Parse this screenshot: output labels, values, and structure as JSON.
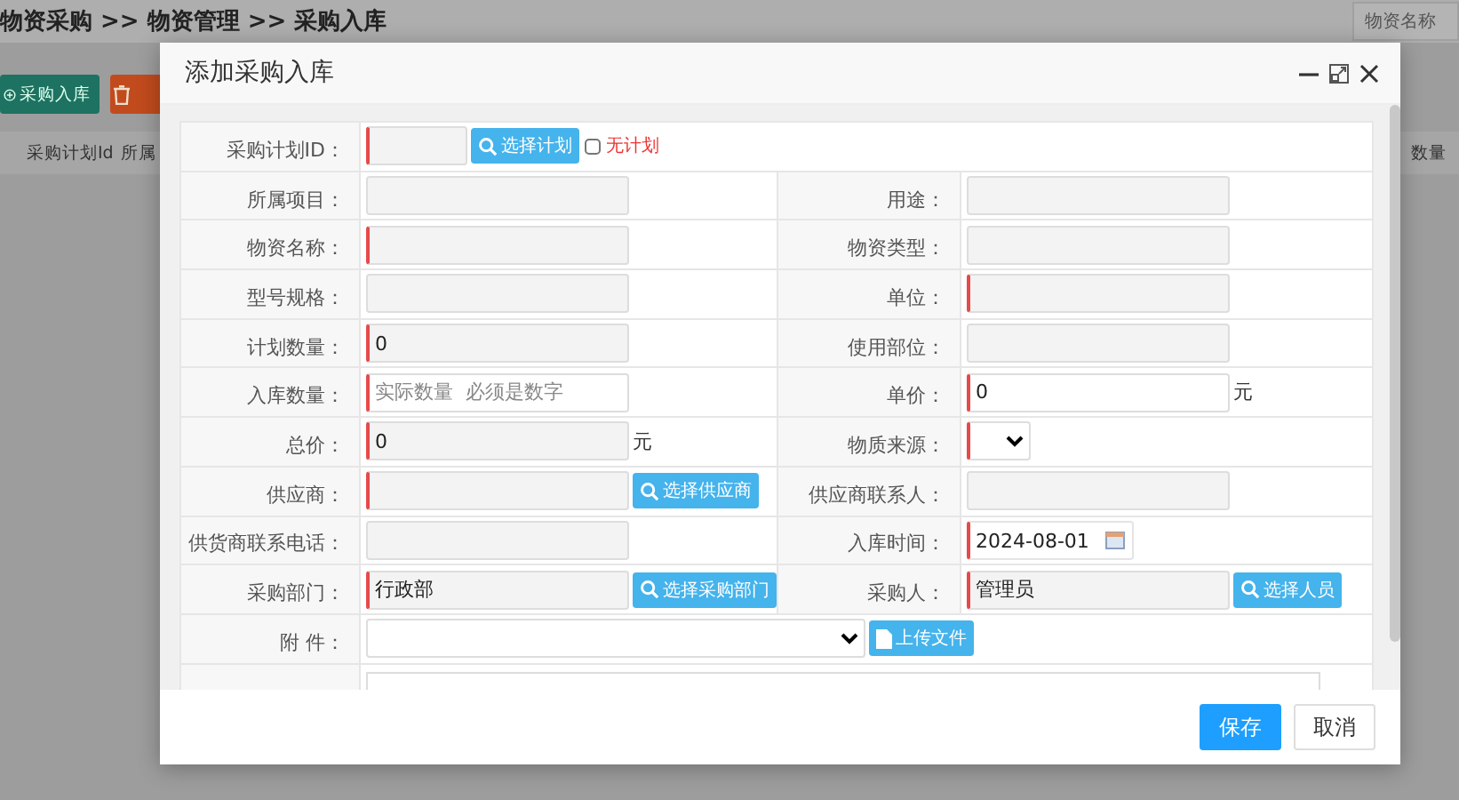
{
  "page": {
    "breadcrumb": "物资采购 >> 物资管理 >> 采购入库",
    "search_placeholder": "物资名称",
    "toolbar": [
      {
        "kind": "add",
        "label": "采购入库"
      },
      {
        "kind": "delete"
      }
    ],
    "columns": [
      "采购计划Id",
      "所属",
      "数量"
    ]
  },
  "dialog": {
    "title": "添加采购入库",
    "rows": [
      {
        "cells": [
          {
            "label": "采购计划ID：",
            "control": {
              "kind": "short",
              "required": true,
              "readonly": true,
              "button": {
                "label": "选择计划",
                "kind": "search"
              },
              "checkbox": {
                "label": "无计划",
                "checked": false
              }
            }
          }
        ]
      },
      {
        "cells": [
          {
            "label": "所属项目：",
            "control": {
              "kind": "text",
              "required": false,
              "readonly": true
            }
          },
          {
            "label": "用途：",
            "control": {
              "kind": "text",
              "required": false,
              "readonly": true
            }
          }
        ]
      },
      {
        "cells": [
          {
            "label": "物资名称：",
            "control": {
              "kind": "text",
              "required": true,
              "readonly": true
            }
          },
          {
            "label": "物资类型：",
            "control": {
              "kind": "text",
              "required": false,
              "readonly": true
            }
          }
        ]
      },
      {
        "cells": [
          {
            "label": "型号规格：",
            "control": {
              "kind": "text",
              "required": false,
              "readonly": true
            }
          },
          {
            "label": "单位：",
            "control": {
              "kind": "text",
              "required": true,
              "readonly": true
            }
          }
        ]
      },
      {
        "cells": [
          {
            "label": "计划数量：",
            "control": {
              "kind": "text",
              "value": "0",
              "required": true,
              "readonly": true
            }
          },
          {
            "label": "使用部位：",
            "control": {
              "kind": "text",
              "required": false,
              "readonly": true
            }
          }
        ]
      },
      {
        "cells": [
          {
            "label": "入库数量：",
            "control": {
              "kind": "text",
              "placeholder": "实际数量  必须是数字",
              "required": true,
              "readonly": false
            }
          },
          {
            "label": "单价：",
            "control": {
              "kind": "text",
              "value": "0",
              "required": true,
              "readonly": false,
              "suffix": "元"
            }
          }
        ]
      },
      {
        "cells": [
          {
            "label": "总价：",
            "control": {
              "kind": "text",
              "value": "0",
              "required": true,
              "readonly": true,
              "suffix": "元"
            }
          },
          {
            "label": "物质来源：",
            "control": {
              "kind": "select",
              "required": true
            }
          }
        ]
      },
      {
        "cells": [
          {
            "label": "供应商：",
            "control": {
              "kind": "text",
              "required": true,
              "readonly": true,
              "button": {
                "label": "选择供应商",
                "kind": "search"
              }
            }
          },
          {
            "label": "供应商联系人：",
            "control": {
              "kind": "text",
              "required": false,
              "readonly": true
            }
          }
        ]
      },
      {
        "cells": [
          {
            "label": "供货商联系电话：",
            "control": {
              "kind": "text",
              "required": false,
              "readonly": true
            }
          },
          {
            "label": "入库时间：",
            "control": {
              "kind": "date",
              "value": "2024-08-01",
              "required": true
            }
          }
        ]
      },
      {
        "cells": [
          {
            "label": "采购部门：",
            "control": {
              "kind": "text",
              "value": "行政部",
              "required": true,
              "readonly": true,
              "button": {
                "label": "选择采购部门",
                "kind": "search"
              }
            }
          },
          {
            "label": "采购人：",
            "control": {
              "kind": "text",
              "value": "管理员",
              "required": true,
              "readonly": true,
              "button": {
                "label": "选择人员",
                "kind": "search"
              }
            }
          }
        ]
      },
      {
        "cells": [
          {
            "label": "附 件：",
            "control": {
              "kind": "wideselect",
              "required": false,
              "button": {
                "label": "上传文件",
                "kind": "file"
              }
            }
          }
        ]
      },
      {
        "cells": [
          {
            "control": {
              "kind": "textarea"
            }
          }
        ]
      }
    ],
    "buttons": [
      {
        "label": "保存",
        "primary": true
      },
      {
        "label": "取消",
        "primary": false
      }
    ]
  }
}
